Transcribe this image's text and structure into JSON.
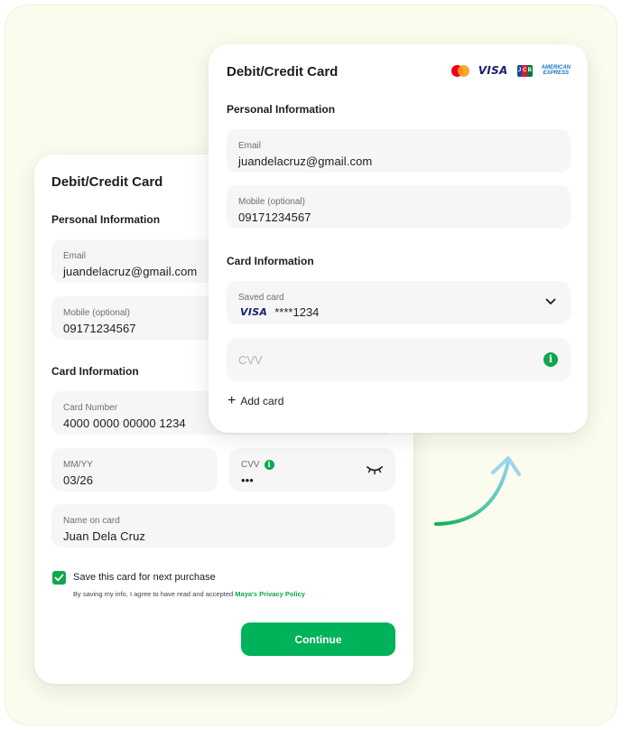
{
  "back_card": {
    "title": "Debit/Credit Card",
    "personal_section": "Personal Information",
    "email_label": "Email",
    "email_value": "juandelacruz@gmail.com",
    "mobile_label": "Mobile (optional)",
    "mobile_value": "09171234567",
    "card_section": "Card Information",
    "card_number_label": "Card Number",
    "card_number_value": "4000 0000 00000 1234",
    "mmyy_label": "MM/YY",
    "mmyy_value": "03/26",
    "cvv_label": "CVV",
    "cvv_value": "•••",
    "name_label": "Name on card",
    "name_value": "Juan Dela Cruz",
    "save_label": "Save this card for next purchase",
    "save_checked": true,
    "consent_text": "By saving my info, I agree to have read and accepted ",
    "consent_link": "Maya's Privacy Policy",
    "continue_label": "Continue",
    "info_glyph": "i"
  },
  "front_card": {
    "title": "Debit/Credit Card",
    "brands": [
      "mastercard-icon",
      "visa-icon",
      "jcb-icon",
      "amex-icon"
    ],
    "visa_text": "VISA",
    "jcb_letters": [
      "J",
      "C",
      "B"
    ],
    "amex_text": [
      "AMERICAN",
      "EXPRESS"
    ],
    "personal_section": "Personal Information",
    "email_label": "Email",
    "email_value": "juandelacruz@gmail.com",
    "mobile_label": "Mobile (optional)",
    "mobile_value": "09171234567",
    "card_section": "Card Information",
    "saved_card_label": "Saved card",
    "saved_card_brand": "VISA",
    "saved_card_number": "****1234",
    "cvv_placeholder": "CVV",
    "info_glyph": "i",
    "add_card_plus": "+",
    "add_card_label": "Add card"
  },
  "colors": {
    "accent": "#00b259",
    "background": "#fbfbee",
    "field": "#f6f6f6",
    "visa_blue": "#1a1f71"
  }
}
